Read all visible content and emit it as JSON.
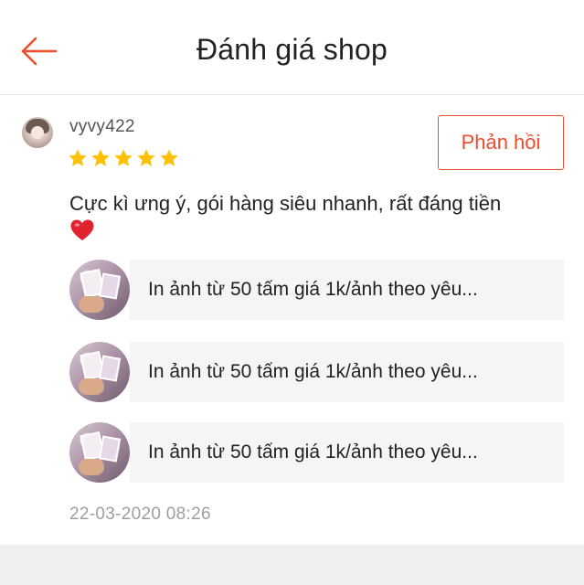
{
  "header": {
    "title": "Đánh giá shop",
    "back_icon": "arrow-left-icon"
  },
  "colors": {
    "accent": "#ee4d2d",
    "star": "#ffc107",
    "heart": "#e0242f"
  },
  "review": {
    "username": "vyvy422",
    "rating": 5,
    "reply_label": "Phản hồi",
    "comment": "Cực kì ưng ý, gói hàng siêu nhanh, rất đáng tiền",
    "comment_emoji": "heart-icon",
    "products": [
      {
        "name": "In ảnh từ 50 tấm giá 1k/ảnh theo yêu..."
      },
      {
        "name": "In ảnh từ 50 tấm giá 1k/ảnh theo yêu..."
      },
      {
        "name": "In ảnh từ 50 tấm giá 1k/ảnh theo yêu..."
      }
    ],
    "timestamp": "22-03-2020 08:26"
  }
}
